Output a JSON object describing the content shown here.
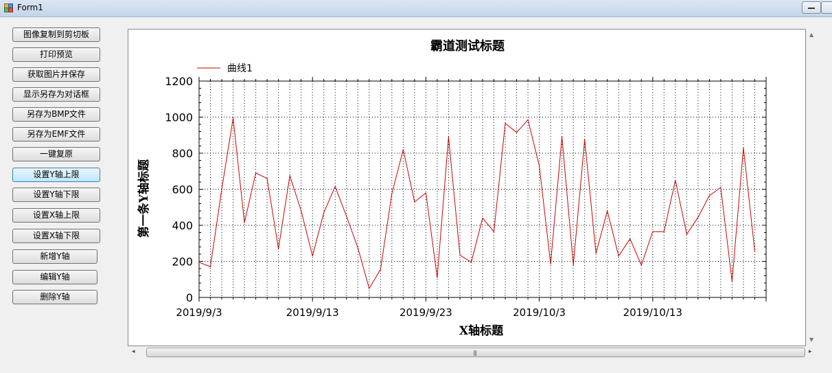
{
  "window": {
    "title": "Form1",
    "icons": [
      "form-app-icon",
      "minimize-icon"
    ]
  },
  "buttons": [
    {
      "id": "copy",
      "label": "图像复制到剪切板",
      "active": false
    },
    {
      "id": "print",
      "label": "打印预览",
      "active": false
    },
    {
      "id": "get",
      "label": "获取图片并保存",
      "active": false
    },
    {
      "id": "saveas",
      "label": "显示另存为对话框",
      "active": false
    },
    {
      "id": "bmp",
      "label": "另存为BMP文件",
      "active": false
    },
    {
      "id": "emf",
      "label": "另存为EMF文件",
      "active": false
    },
    {
      "id": "reset",
      "label": "一键复原",
      "active": false
    },
    {
      "id": "ymax",
      "label": "设置Y轴上限",
      "active": true
    },
    {
      "id": "ymin",
      "label": "设置Y轴下限",
      "active": false
    },
    {
      "id": "xmax",
      "label": "设置X轴上限",
      "active": false
    },
    {
      "id": "xmin",
      "label": "设置X轴下限",
      "active": false
    },
    {
      "id": "addy",
      "label": "新增Y轴",
      "active": false
    },
    {
      "id": "edity",
      "label": "编辑Y轴",
      "active": false
    },
    {
      "id": "delety",
      "label": "删除Y轴",
      "active": false
    }
  ],
  "colors": {
    "series": "#cc0000",
    "grid": "#000000",
    "accent": "#3c7fb1"
  },
  "chart_data": {
    "type": "line",
    "title": "霸道测试标题",
    "xlabel": "X轴标题",
    "ylabel": "第一条Y轴标题",
    "ylim": [
      0,
      1200
    ],
    "yticks": [
      0,
      200,
      400,
      600,
      800,
      1000,
      1200
    ],
    "xlim": [
      "2019-09-03",
      "2019-10-23"
    ],
    "xtick_labels": [
      "2019/9/3",
      "2019/9/13",
      "2019/9/23",
      "2019/10/3",
      "2019/10/13"
    ],
    "grid": true,
    "legend": {
      "position": "top-left"
    },
    "series": [
      {
        "name": "曲线1",
        "x": [
          "2019-09-03",
          "2019-09-04",
          "2019-09-05",
          "2019-09-06",
          "2019-09-07",
          "2019-09-08",
          "2019-09-09",
          "2019-09-10",
          "2019-09-11",
          "2019-09-12",
          "2019-09-13",
          "2019-09-14",
          "2019-09-15",
          "2019-09-16",
          "2019-09-17",
          "2019-09-18",
          "2019-09-19",
          "2019-09-20",
          "2019-09-21",
          "2019-09-22",
          "2019-09-23",
          "2019-09-24",
          "2019-09-25",
          "2019-09-26",
          "2019-09-27",
          "2019-09-28",
          "2019-09-29",
          "2019-09-30",
          "2019-10-01",
          "2019-10-02",
          "2019-10-03",
          "2019-10-04",
          "2019-10-05",
          "2019-10-06",
          "2019-10-07",
          "2019-10-08",
          "2019-10-09",
          "2019-10-10",
          "2019-10-11",
          "2019-10-12",
          "2019-10-13",
          "2019-10-14",
          "2019-10-15",
          "2019-10-16",
          "2019-10-17",
          "2019-10-18",
          "2019-10-19",
          "2019-10-20",
          "2019-10-21",
          "2019-10-22"
        ],
        "y": [
          195,
          170,
          600,
          995,
          415,
          690,
          660,
          270,
          675,
          480,
          230,
          470,
          615,
          450,
          275,
          50,
          155,
          575,
          820,
          530,
          580,
          110,
          890,
          235,
          195,
          440,
          365,
          965,
          915,
          985,
          730,
          185,
          890,
          180,
          875,
          245,
          480,
          230,
          325,
          180,
          365,
          365,
          650,
          350,
          445,
          565,
          610,
          90,
          830,
          255
        ]
      }
    ]
  }
}
